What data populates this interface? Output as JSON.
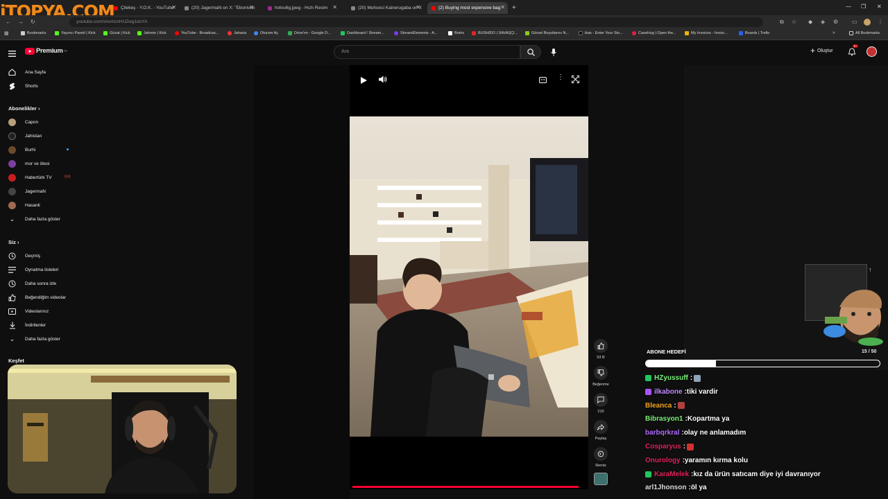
{
  "browser": {
    "tabs": [
      {
        "label": "Çilekeş - Y.O.K. - YouTube",
        "color": "#ff0000"
      },
      {
        "label": "(20) JagermaN on X: \"Ebonivon",
        "color": "#888888"
      },
      {
        "label": "hotvu6g.jpeg - Hızlı Resim",
        "color": "#9b2c8f"
      },
      {
        "label": "(20) Muhooci Kainerugaba on X",
        "color": "#888888"
      },
      {
        "label": "(2) Buying most expensive bag",
        "color": "#ff0000"
      }
    ],
    "url": "youtube.com/shorts/xHUZwg1doYA",
    "bookmarks": [
      {
        "label": "Bookmarks",
        "color": "#cccccc"
      },
      {
        "label": "Yayıncı Paneli | Kick",
        "color": "#53fc18"
      },
      {
        "label": "Gözat | Kick",
        "color": "#53fc18"
      },
      {
        "label": "Jahrein | Kick",
        "color": "#53fc18"
      },
      {
        "label": "YouTube - Broadcas...",
        "color": "#ff0000"
      },
      {
        "label": "Jaharia",
        "color": "#ff3333"
      },
      {
        "label": "Oturum Aç",
        "color": "#4285f4"
      },
      {
        "label": "Drive'ım - Google D...",
        "color": "#34a853"
      },
      {
        "label": "Dashboard / Stream...",
        "color": "#22c55e"
      },
      {
        "label": "StreamElements - A...",
        "color": "#7c3aed"
      },
      {
        "label": "Botrix",
        "color": "#ffffff"
      },
      {
        "label": "BUSHIDO | SAVAŞÇI...",
        "color": "#dc2626"
      },
      {
        "label": "Görsel Boyutlarını N...",
        "color": "#84cc16"
      },
      {
        "label": "ikas - Enter Your Sto...",
        "color": "#111111"
      },
      {
        "label": "CaseHug | Open the...",
        "color": "#e11d48"
      },
      {
        "label": "My Invoices - Invoic...",
        "color": "#eab308"
      },
      {
        "label": "Boards | Trello",
        "color": "#2563eb"
      },
      {
        "label": "All Bookmarks",
        "color": "#cccccc"
      }
    ]
  },
  "yt": {
    "logo": "Premium",
    "logo_sup": "TR",
    "search_placeholder": "Ara",
    "create_label": "Oluştur",
    "notif_count": "9+"
  },
  "sidebar": {
    "main": [
      {
        "label": "Ana Sayfa",
        "icon": "home-icon"
      },
      {
        "label": "Shorts",
        "icon": "shorts-icon"
      }
    ],
    "subs_title": "Abonelikler",
    "subs": [
      {
        "label": "Capon",
        "color": "#b8a07a"
      },
      {
        "label": "Jahistan",
        "color": "#222222"
      },
      {
        "label": "Burhi",
        "color": "#6b4a2a"
      },
      {
        "label": "mor ve ötesi",
        "color": "#7a3fa0"
      },
      {
        "label": "Habertürk TV",
        "color": "#c81e1e"
      },
      {
        "label": "JagermaN",
        "color": "#444444"
      },
      {
        "label": "Hasanli",
        "color": "#a06a50"
      }
    ],
    "subs_more": "Daha fazla göster",
    "you_title": "Siz",
    "you": [
      {
        "label": "Geçmiş",
        "icon": "history-icon"
      },
      {
        "label": "Oynatma listeleri",
        "icon": "playlist-icon"
      },
      {
        "label": "Daha sonra izle",
        "icon": "clock-icon"
      },
      {
        "label": "Beğendiğim videolar",
        "icon": "like-icon"
      },
      {
        "label": "Videolarınız",
        "icon": "video-icon"
      },
      {
        "label": "İndirilenler",
        "icon": "download-icon"
      }
    ],
    "you_more": "Daha fazla göster",
    "explore_title": "Keşfet"
  },
  "actions": {
    "likes": "53 B",
    "dislike": "Beğenme",
    "comments": "210",
    "share": "Paylaş",
    "remix": "Remix"
  },
  "overlay": {
    "logo_text": "iTOPYA.COM",
    "sub_goal_title": "ABONE HEDEFİ",
    "sub_goal_count": "15 / 50",
    "sub_goal_progress": 0.3,
    "chat": [
      {
        "user": "HZyussuff",
        "msg": "",
        "color": "#7cf27c",
        "badge": "#22c55e",
        "emote": "#8fa3b8"
      },
      {
        "user": "ilkabone",
        "msg": "tiki vardir",
        "color": "#c48cff",
        "badge": "#a855f7",
        "emote": ""
      },
      {
        "user": "Bleanca",
        "msg": "",
        "color": "#f5a623",
        "badge": "",
        "emote": "#b0413e"
      },
      {
        "user": "Bibrasyon1",
        "msg": "Kopartma ya",
        "color": "#7cf27c",
        "badge": "",
        "emote": ""
      },
      {
        "user": "barbqrkral",
        "msg": "olay ne anlamadım",
        "color": "#b26bff",
        "badge": "",
        "emote": ""
      },
      {
        "user": "Cosparyus",
        "msg": "",
        "color": "#e0245e",
        "badge": "",
        "emote": "#d0312d"
      },
      {
        "user": "Onurology",
        "msg": "yaramın kırma kolu",
        "color": "#e0245e",
        "badge": "",
        "emote": ""
      },
      {
        "user": "KaraMelek",
        "msg": "kız da ürün satıcam diye iyi davranıyor",
        "color": "#e0245e",
        "badge": "#22c55e",
        "emote": ""
      },
      {
        "user": "arl1Jhonson",
        "msg": "öl ya",
        "color": "#dddddd",
        "badge": "",
        "emote": ""
      }
    ]
  }
}
